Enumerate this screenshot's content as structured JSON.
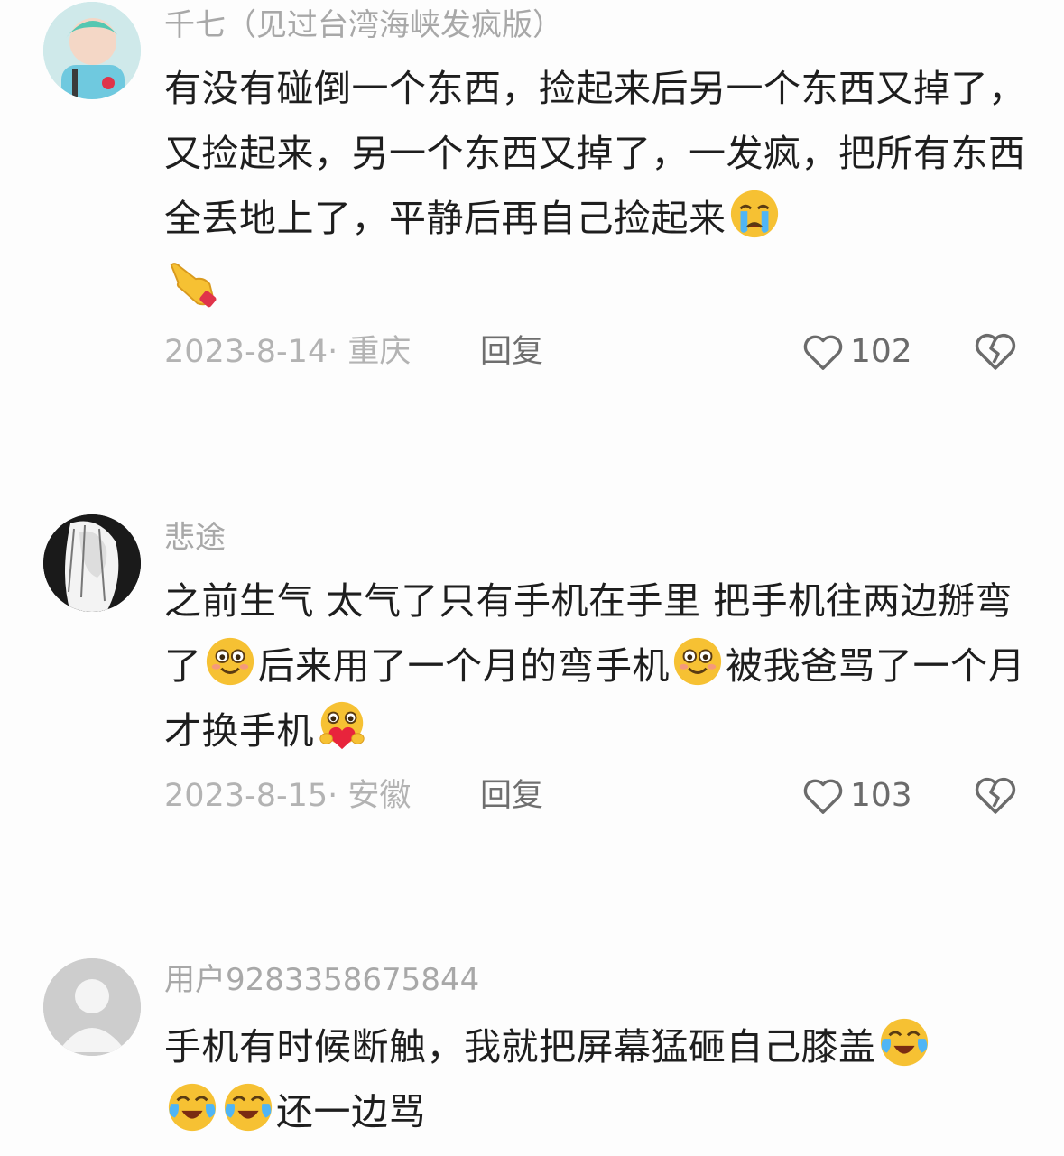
{
  "comments": [
    {
      "username": "千七（见过台湾海峡发疯版）",
      "text_parts": [
        "有没有碰倒一个东西，捡起来后另一个东西又掉了，又捡起来，另一个东西又掉了，一发疯，把所有东西全丢地上了，平静后再自己捡起来"
      ],
      "emojis": [
        "crying-emoji",
        "pointing-hand-emoji"
      ],
      "date_location": "2023-8-14· 重庆",
      "reply_label": "回复",
      "likes": "102"
    },
    {
      "username": "悲途",
      "text_parts": [
        "之前生气 太气了只有手机在手里 把手机往两边掰弯了",
        "后来用了一个月的弯手机",
        "被我爸骂了一个月才换手机"
      ],
      "emojis": [
        "smile-emoji",
        "smile-emoji",
        "heart-hug-emoji"
      ],
      "date_location": "2023-8-15· 安徽",
      "reply_label": "回复",
      "likes": "103"
    },
    {
      "username": "用户9283358675844",
      "text_parts": [
        "手机有时候断触，我就把屏幕猛砸自己膝盖",
        "还一边骂"
      ],
      "emojis": [
        "tears-of-joy-emoji",
        "tears-of-joy-emoji",
        "tears-of-joy-emoji"
      ]
    }
  ],
  "colors": {
    "meta": "#b3b3b3",
    "text": "#1e1e1e",
    "emoji": "#f7c531"
  }
}
